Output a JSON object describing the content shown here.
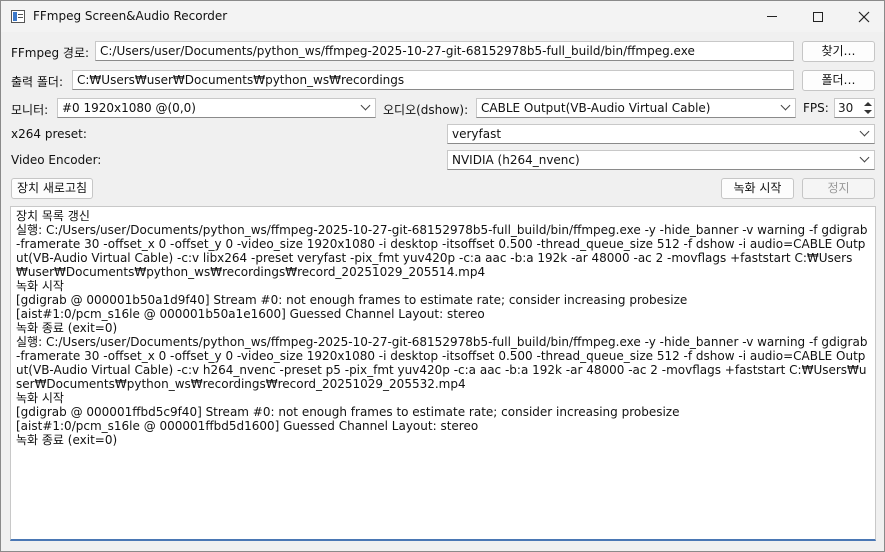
{
  "window": {
    "title": "FFmpeg Screen&Audio Recorder"
  },
  "ffmpeg_path": {
    "label": "FFmpeg 경로:",
    "value": "C:/Users/user/Documents/python_ws/ffmpeg-2025-10-27-git-68152978b5-full_build/bin/ffmpeg.exe",
    "browse_label": "찾기…"
  },
  "output_folder": {
    "label": "출력 폴더:",
    "value": "C:₩Users₩user₩Documents₩python_ws₩recordings",
    "browse_label": "폴더…"
  },
  "monitor": {
    "label": "모니터:",
    "selected": "#0  1920x1080  @(0,0)"
  },
  "audio": {
    "label": "오디오(dshow):",
    "selected": "CABLE Output(VB-Audio Virtual Cable)"
  },
  "fps": {
    "label": "FPS:",
    "value": "30"
  },
  "x264_preset": {
    "label": "x264 preset:",
    "selected": "veryfast"
  },
  "video_encoder": {
    "label": "Video Encoder:",
    "selected": "NVIDIA (h264_nvenc)"
  },
  "buttons": {
    "refresh_devices": "장치 새로고침",
    "start_recording": "녹화 시작",
    "stop": "정지"
  },
  "log": {
    "lines": [
      "장치 목록 갱신",
      "실행: C:/Users/user/Documents/python_ws/ffmpeg-2025-10-27-git-68152978b5-full_build/bin/ffmpeg.exe -y -hide_banner -v warning -f gdigrab -framerate 30 -offset_x 0 -offset_y 0 -video_size 1920x1080 -i desktop -itsoffset 0.500 -thread_queue_size 512 -f dshow -i audio=CABLE Output(VB-Audio Virtual Cable) -c:v libx264 -preset veryfast -pix_fmt yuv420p -c:a aac -b:a 192k -ar 48000 -ac 2 -movflags +faststart C:₩Users₩user₩Documents₩python_ws₩recordings₩record_20251029_205514.mp4",
      "녹화 시작",
      "[gdigrab @ 000001b50a1d9f40] Stream #0: not enough frames to estimate rate; consider increasing probesize",
      "[aist#1:0/pcm_s16le @ 000001b50a1e1600] Guessed Channel Layout: stereo",
      "녹화 종료 (exit=0)",
      "실행: C:/Users/user/Documents/python_ws/ffmpeg-2025-10-27-git-68152978b5-full_build/bin/ffmpeg.exe -y -hide_banner -v warning -f gdigrab -framerate 30 -offset_x 0 -offset_y 0 -video_size 1920x1080 -i desktop -itsoffset 0.500 -thread_queue_size 512 -f dshow -i audio=CABLE Output(VB-Audio Virtual Cable) -c:v h264_nvenc -preset p5 -pix_fmt yuv420p -c:a aac -b:a 192k -ar 48000 -ac 2 -movflags +faststart C:₩Users₩user₩Documents₩python_ws₩recordings₩record_20251029_205532.mp4",
      "녹화 시작",
      "[gdigrab @ 000001ffbd5c9f40] Stream #0: not enough frames to estimate rate; consider increasing probesize",
      "[aist#1:0/pcm_s16le @ 000001ffbd5d1600] Guessed Channel Layout: stereo",
      "녹화 종료 (exit=0)"
    ]
  },
  "colors": {
    "accent": "#4a77b4",
    "window_bg": "#f0f0f0"
  }
}
